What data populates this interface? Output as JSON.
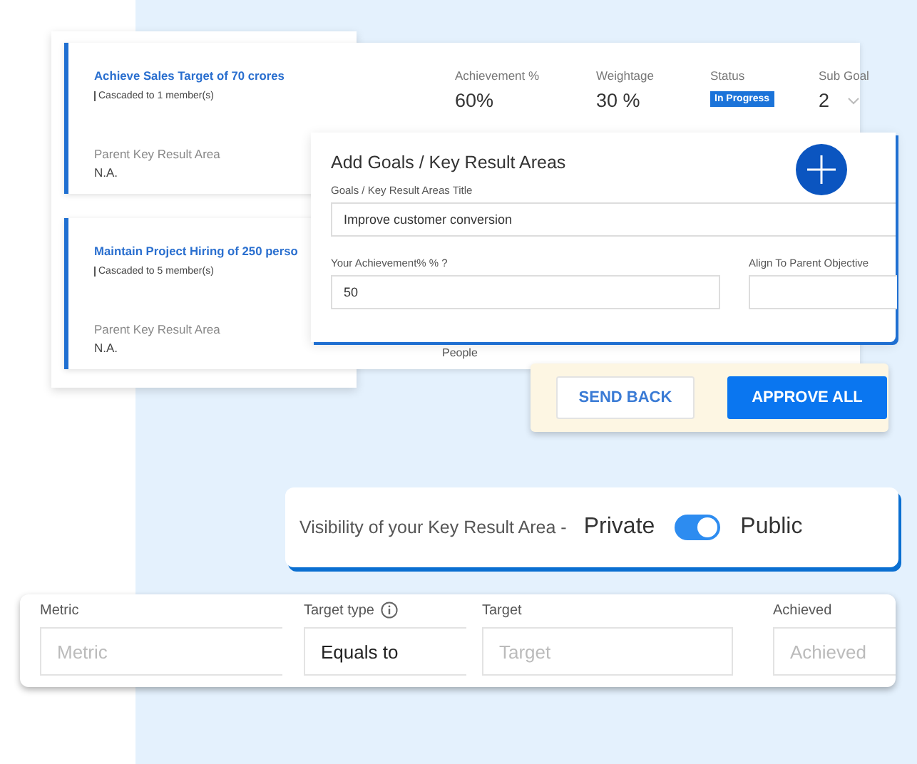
{
  "goals": [
    {
      "title": "Achieve Sales Target of 70 crores",
      "cascaded": "Cascaded to 1 member(s)",
      "parent_label": "Parent Key Result Area",
      "parent_value": "N.A.",
      "stats": [
        {
          "label": "Achievement %",
          "value": "60%",
          "kind": "number"
        },
        {
          "label": "Weightage",
          "value": "30 %",
          "kind": "number"
        },
        {
          "label": "Status",
          "value": "In Progress",
          "kind": "badge"
        },
        {
          "label": "Sub Goal",
          "value": "2",
          "kind": "dropdown"
        }
      ]
    },
    {
      "title": "Maintain Project Hiring of 250 perso",
      "cascaded": "Cascaded to 5 member(s)",
      "parent_label": "Parent Key Result Area",
      "parent_value": "N.A.",
      "note": "People"
    }
  ],
  "add_goal": {
    "title": "Add Goals / Key Result Areas",
    "fields": [
      {
        "label": "Goals / Key Result Areas Title",
        "value": "Improve customer conversion"
      },
      {
        "label": "Your Achievement% % ?",
        "value": "50"
      },
      {
        "label": "Align To Parent Objective"
      }
    ]
  },
  "actions": [
    {
      "label": "SEND BACK",
      "kind": "secondary"
    },
    {
      "label": "APPROVE ALL",
      "kind": "primary"
    }
  ],
  "visibility": {
    "label": "Visibility of your Key Result Area -",
    "off_label": "Private",
    "on_label": "Public",
    "on": true
  },
  "metric_row": [
    {
      "label": "Metric",
      "placeholder": "Metric"
    },
    {
      "label": "Target type",
      "info": true,
      "value": "Equals to"
    },
    {
      "label": "Target",
      "placeholder": "Target"
    },
    {
      "label": "Achieved",
      "placeholder": "Achieved"
    }
  ]
}
